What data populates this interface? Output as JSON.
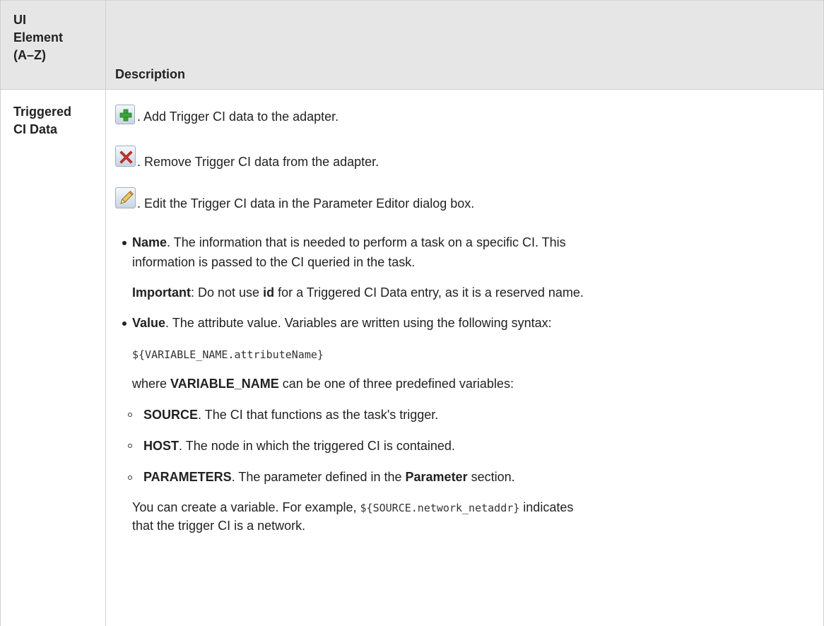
{
  "table": {
    "header": {
      "col1_lines": [
        "UI",
        "Element",
        "(A–Z)"
      ],
      "col2": "Description"
    },
    "row": {
      "element_lines": [
        "Triggered",
        "CI Data"
      ],
      "add_text": ". Add Trigger CI data to the adapter.",
      "remove_text": ". Remove Trigger CI data from the adapter.",
      "edit_text": ". Edit the Trigger CI data in the Parameter Editor dialog box.",
      "name": {
        "term": "Name",
        "text1": ". The information that is needed to perform a task on a specific CI. This",
        "text2": "information is passed to the CI queried in the task."
      },
      "important": {
        "term": "Important",
        "text_a": ": Do not use ",
        "code_word": "id",
        "text_b": " for a Triggered CI Data entry, as it is a reserved name."
      },
      "value": {
        "term": "Value",
        "text": ". The attribute value. Variables are written using the following syntax:"
      },
      "syntax": "${VARIABLE_NAME.attributeName}",
      "where": {
        "text_a": "where ",
        "term": "VARIABLE_NAME",
        "text_b": " can be one of three predefined variables:"
      },
      "variables": [
        {
          "term": "SOURCE",
          "text": ". The CI that functions as the task's trigger."
        },
        {
          "term": "HOST",
          "text": ". The node in which the triggered CI is contained."
        },
        {
          "term": "PARAMETERS",
          "text_a": ". The parameter defined in the ",
          "term2": "Parameter",
          "text_b": " section."
        }
      ],
      "example": {
        "text_a": "You can create a variable. For example, ",
        "code": "${SOURCE.network_netaddr}",
        "text_b": " indicates",
        "text_c": "that the trigger CI is a network."
      }
    }
  },
  "icons": [
    "add-icon",
    "remove-icon",
    "edit-icon"
  ],
  "colors": {
    "header_bg": "#e6e6e6",
    "border": "#cfcfcf",
    "add_green": "#3aa53a",
    "remove_red": "#d6312b"
  }
}
